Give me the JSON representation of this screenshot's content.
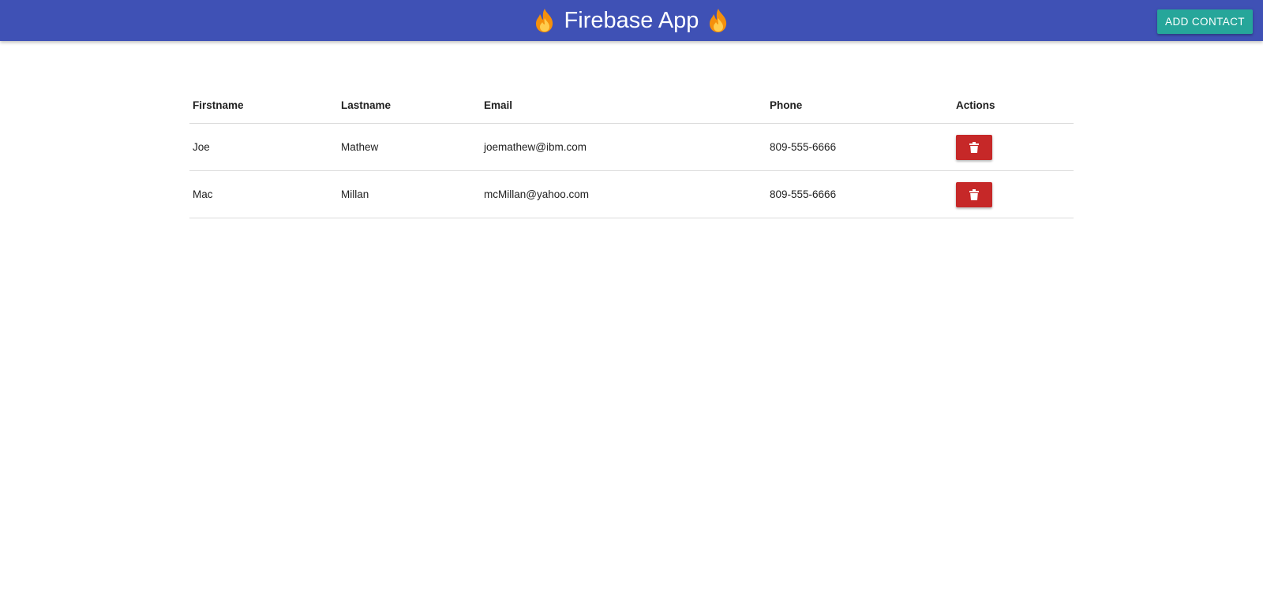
{
  "header": {
    "title": "Firebase App",
    "left_icon": "flame-icon",
    "right_icon": "flame-icon",
    "add_button_label": "ADD CONTACT",
    "bar_color": "#3f51b5",
    "add_button_color": "#26a69a"
  },
  "table": {
    "columns": [
      "Firstname",
      "Lastname",
      "Email",
      "Phone",
      "Actions"
    ],
    "rows": [
      {
        "firstname": "Joe",
        "lastname": "Mathew",
        "email": "joemathew@ibm.com",
        "phone": "809-555-6666",
        "action_icon": "trash-icon"
      },
      {
        "firstname": "Mac",
        "lastname": "Millan",
        "email": "mcMillan@yahoo.com",
        "phone": "809-555-6666",
        "action_icon": "trash-icon"
      }
    ],
    "delete_button_color": "#c62828"
  }
}
